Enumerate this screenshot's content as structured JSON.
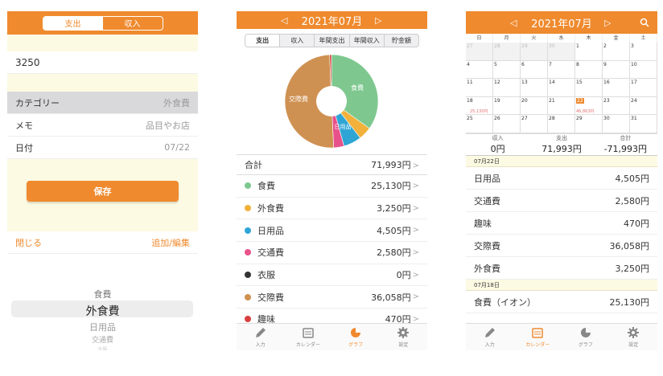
{
  "input": {
    "seg": [
      "支出",
      "収入"
    ],
    "amount": "3250",
    "rows": [
      {
        "label": "カテゴリー",
        "value": "外食費"
      },
      {
        "label": "メモ",
        "value": "品目やお店"
      },
      {
        "label": "日付",
        "value": "07/22"
      }
    ],
    "save": "保存",
    "close": "閉じる",
    "add_edit": "追加/編集",
    "picker": [
      "食費",
      "外食費",
      "日用品",
      "交通費",
      "衣服"
    ]
  },
  "graph": {
    "prev": "◁",
    "next": "▷",
    "month": "2021年07月",
    "tabs": [
      "支出",
      "収入",
      "年間支出",
      "年間収入",
      "貯金額"
    ],
    "pie_labels": {
      "food": "食費",
      "social": "交際費",
      "daily": "日用品"
    },
    "total_label": "合計",
    "total": "71,993円",
    "categories": [
      {
        "label": "食費",
        "value": "25,130円",
        "color": "#7ec88f"
      },
      {
        "label": "外食費",
        "value": "3,250円",
        "color": "#f2b13a"
      },
      {
        "label": "日用品",
        "value": "4,505円",
        "color": "#2fa5d6"
      },
      {
        "label": "交通費",
        "value": "2,580円",
        "color": "#e8528a"
      },
      {
        "label": "衣服",
        "value": "0円",
        "color": "#333333"
      },
      {
        "label": "交際費",
        "value": "36,058円",
        "color": "#cf9152"
      },
      {
        "label": "趣味",
        "value": "470円",
        "color": "#d94040"
      }
    ]
  },
  "calendar": {
    "prev": "◁",
    "next": "▷",
    "month": "2021年07月",
    "weekdays": [
      "日",
      "月",
      "火",
      "水",
      "木",
      "金",
      "土"
    ],
    "weeks": [
      [
        "27",
        "28",
        "29",
        "30",
        "1",
        "2",
        "3"
      ],
      [
        "4",
        "5",
        "6",
        "7",
        "8",
        "9",
        "10"
      ],
      [
        "11",
        "12",
        "13",
        "14",
        "15",
        "16",
        "17"
      ],
      [
        "18",
        "19",
        "20",
        "21",
        "22",
        "23",
        "24"
      ],
      [
        "25",
        "26",
        "27",
        "28",
        "29",
        "30",
        "31"
      ]
    ],
    "day_amounts": {
      "a18": "25,130円",
      "a22": "46,863円"
    },
    "summary": [
      {
        "k": "収入",
        "v": "0円"
      },
      {
        "k": "支出",
        "v": "71,993円"
      },
      {
        "k": "合計",
        "v": "-71,993円"
      }
    ],
    "groups": [
      {
        "date": "07月22日",
        "items": [
          {
            "l": "日用品",
            "v": "4,505円"
          },
          {
            "l": "交通費",
            "v": "2,580円"
          },
          {
            "l": "趣味",
            "v": "470円"
          },
          {
            "l": "交際費",
            "v": "36,058円"
          },
          {
            "l": "外食費",
            "v": "3,250円"
          }
        ]
      },
      {
        "date": "07月18日",
        "items": [
          {
            "l": "食費（イオン）",
            "v": "25,130円"
          }
        ]
      }
    ]
  },
  "tabbar": {
    "input": "入力",
    "calendar": "カレンダー",
    "graph": "グラフ",
    "settings": "設定"
  },
  "colors": {
    "accent": "#ef8a2e"
  }
}
